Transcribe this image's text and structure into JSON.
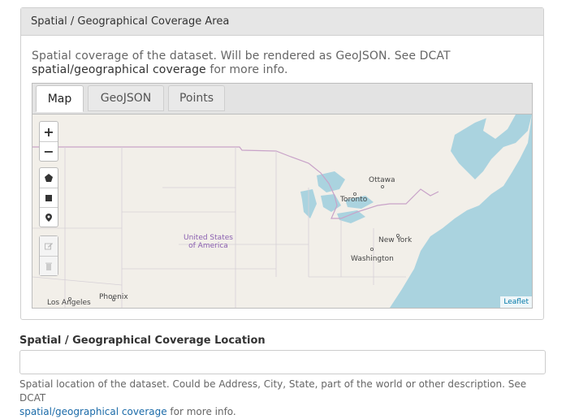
{
  "panel": {
    "title": "Spatial / Geographical Coverage Area",
    "help_text": "Spatial coverage of the dataset. Will be rendered as GeoJSON. See DCAT",
    "help_link": "spatial/geographical coverage",
    "help_suffix": " for more info."
  },
  "tabs": [
    {
      "label": "Map",
      "active": true
    },
    {
      "label": "GeoJSON",
      "active": false
    },
    {
      "label": "Points",
      "active": false
    }
  ],
  "map": {
    "zoom_in": "+",
    "zoom_out": "−",
    "draw_tools": [
      "polygon-icon",
      "rectangle-icon",
      "marker-icon"
    ],
    "edit_tools": [
      "edit-icon",
      "trash-icon"
    ],
    "labels": {
      "ottawa": "Ottawa",
      "toronto": "Toronto",
      "new_york": "New York",
      "washington": "Washington",
      "usa_line1": "United States",
      "usa_line2": "of America",
      "phoenix": "Phoenix",
      "los_angeles": "Los Angeles"
    },
    "attribution": "Leaflet",
    "colors": {
      "land": "#f2efe9",
      "water": "#aad3df",
      "border": "#c8a2c8"
    }
  },
  "location": {
    "label": "Spatial / Geographical Coverage Location",
    "value": "",
    "help_text": "Spatial location of the dataset. Could be Address, City, State, part of the world or other description. See DCAT",
    "help_link": "spatial/geographical coverage",
    "help_suffix": " for more info."
  }
}
